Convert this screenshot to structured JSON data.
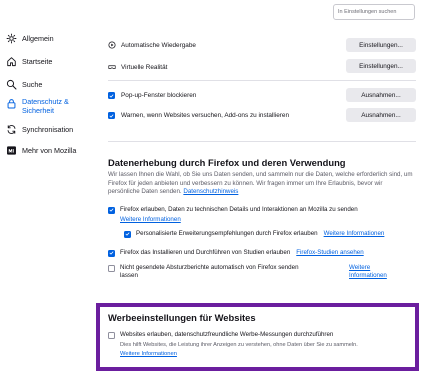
{
  "search": {
    "placeholder": "In Einstellungen suchen"
  },
  "sidebar": {
    "items": [
      {
        "label": "Allgemein",
        "icon": "gear-icon"
      },
      {
        "label": "Startseite",
        "icon": "home-icon"
      },
      {
        "label": "Suche",
        "icon": "search-icon"
      },
      {
        "label_line1": "Datenschutz &",
        "label_line2": "Sicherheit",
        "icon": "lock-icon",
        "active": true
      },
      {
        "label": "Synchronisation",
        "icon": "sync-icon"
      },
      {
        "label": "Mehr von Mozilla",
        "icon": "mozilla-icon"
      }
    ]
  },
  "permissions": {
    "autoplay": {
      "label": "Automatische Wiedergabe",
      "button": "Einstellungen..."
    },
    "vr": {
      "label": "Virtuelle Realität",
      "button": "Einstellungen..."
    },
    "popups": {
      "label": "Pop-up-Fenster blockieren",
      "checked": true,
      "button": "Ausnahmen..."
    },
    "addons": {
      "label": "Warnen, wenn Websites versuchen, Add-ons zu installieren",
      "checked": true,
      "button": "Ausnahmen..."
    }
  },
  "data_collection": {
    "title": "Datenerhebung durch Firefox und deren Verwendung",
    "description": "Wir lassen Ihnen die Wahl, ob Sie uns Daten senden, und sammeln nur die Daten, welche erforderlich sind, um Firefox für jeden anbieten und verbessern zu können. Wir fragen immer um Ihre Erlaubnis, bevor wir persönliche Daten senden.",
    "privacy_link": "Datenschutzhinweis",
    "technical": {
      "label": "Firefox erlauben, Daten zu technischen Details und Interaktionen an Mozilla zu senden",
      "checked": true,
      "link": "Weitere Informationen"
    },
    "recommendations": {
      "label": "Personalisierte Erweiterungsempfehlungen durch Firefox erlauben",
      "checked": true,
      "link": "Weitere Informationen"
    },
    "studies": {
      "label": "Firefox das Installieren und Durchführen von Studien erlauben",
      "checked": true,
      "link": "Firefox-Studien ansehen"
    },
    "crash": {
      "label_line1": "Nicht gesendete Absturzberichte automatisch von Firefox senden",
      "label_line2": "lassen",
      "checked": false,
      "link_line1": "Weitere",
      "link_line2": "Informationen"
    }
  },
  "ad_settings": {
    "title": "Werbeeinstellungen für Websites",
    "option": {
      "label": "Websites erlauben, datenschutzfreundliche Werbe-Messungen durchzuführen",
      "checked": false
    },
    "hint": "Dies hilft Websites, die Leistung ihrer Anzeigen zu verstehen, ohne Daten über Sie zu sammeln.",
    "link": "Weitere Informationen"
  },
  "colors": {
    "accent": "#0061e0",
    "highlight_border": "#6b1e9e",
    "button_bg": "#e9e9ed"
  }
}
